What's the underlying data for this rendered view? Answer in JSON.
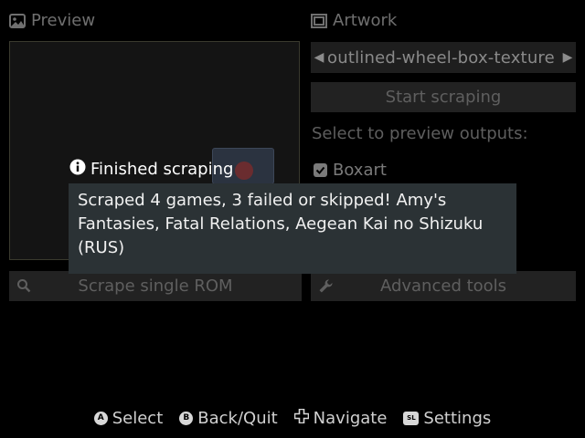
{
  "preview": {
    "title": "Preview"
  },
  "artwork": {
    "title": "Artwork",
    "selected": "outlined-wheel-box-texture",
    "start_label": "Start scraping",
    "outputs_label": "Select to preview outputs:",
    "boxart_label": "Boxart"
  },
  "actions": {
    "scrape_single": "Scrape single ROM",
    "advanced": "Advanced tools"
  },
  "toast": {
    "title": "Finished scraping",
    "message": "Scraped 4 games, 3 failed or skipped! Amy's Fantasies, Fatal Relations, Aegean Kai no Shizuku (RUS)"
  },
  "footer": {
    "items": [
      {
        "glyph": "A",
        "label": "Select"
      },
      {
        "glyph": "B",
        "label": "Back/Quit"
      },
      {
        "glyph": "dpad",
        "label": "Navigate"
      },
      {
        "glyph": "SL",
        "label": "Settings"
      }
    ]
  },
  "colors": {
    "background": "#000000",
    "toast_bg": "#2b3235",
    "button_bg": "#222222"
  }
}
